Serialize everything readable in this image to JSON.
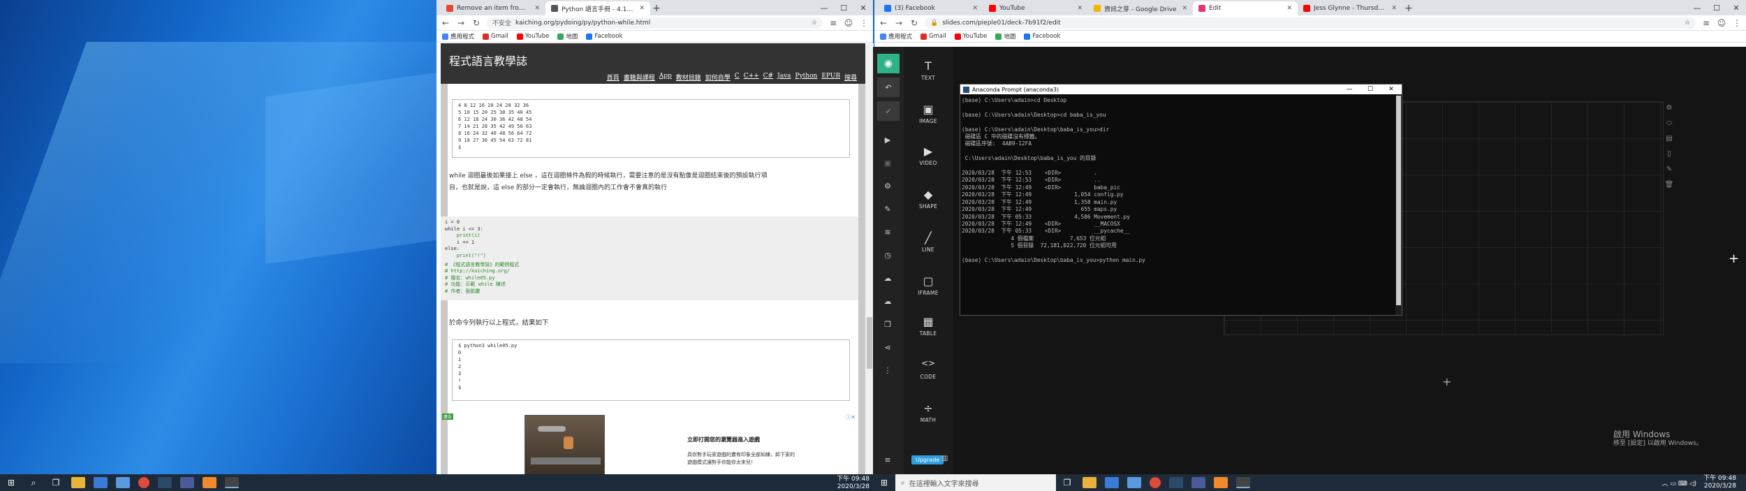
{
  "left_browser": {
    "tabs": [
      {
        "title": "Remove an item from a list in ...",
        "active": false,
        "color": "#ea4335"
      },
      {
        "title": "Python 語言手冊 - 4.12 迴圈與無...",
        "active": true,
        "color": "#555555"
      }
    ],
    "address": {
      "security": "不安全",
      "url": "kaiching.org/pydoing/py/python-while.html"
    },
    "bookmarks": [
      "應用程式",
      "Gmail",
      "YouTube",
      "地圖",
      "Facebook"
    ],
    "site": {
      "title": "程式語言教學誌",
      "nav": [
        "首頁",
        "書籍與課程",
        "App",
        "教材目錄",
        "如何自學",
        "C",
        "C++",
        "C#",
        "Java",
        "Python",
        "EPUB",
        "搜尋"
      ]
    },
    "code_top": [
      "4 8 12 16 20 24 28 32 36",
      "5 10 15 20 25 30 35 40 45",
      "6 12 18 24 30 36 42 48 54",
      "7 14 21 28 35 42 49 56 63",
      "8 16 24 32 40 48 56 64 72",
      "9 18 27 36 45 54 63 72 81",
      "$"
    ],
    "para1_line1": "while 迴圈最後如果接上 else ，這在迴圈條件為假的時候執行，需要注意的是沒有點像是迴圈結束後的預設執行項",
    "para1_line2": "目，也就是說，這 else 的部分一定會執行，無論迴圈內的工作會不會真的執行",
    "code_mid": [
      "i = 0",
      "while i <= 3:",
      "    print(i)",
      "    i += 1",
      "else:",
      "    print(\"!\")"
    ],
    "code_comments": [
      "# 《程式語言教學誌》的範例程式",
      "# http://kaiching.org/",
      "# 檔名：while05.py",
      "# 功能：示範 while 陳述",
      "# 作者：張凱慶"
    ],
    "para2": "於命令列執行以上程式，結果如下",
    "code_out": [
      "$ python3 while05.py",
      "0",
      "1",
      "2",
      "3",
      "!",
      "$"
    ],
    "ad": {
      "badge": "廣告",
      "headline": "立即打開您的瀏覽器進入遊戲",
      "body_line1": "具你對手玩家遊戲的畫有印象全部如練，卸下家的",
      "body_line2": "遊戲模式讓對手你能你太來兒！"
    },
    "taskbar": {
      "time": "下午 09:48",
      "date": "2020/3/28"
    }
  },
  "right_browser": {
    "tabs": [
      {
        "title": "(3) Facebook",
        "active": false,
        "color": "#1877f2"
      },
      {
        "title": "YouTube",
        "active": false,
        "color": "#ff0000"
      },
      {
        "title": "資訊之芽 - Google Drive",
        "active": false,
        "color": "#f4b400"
      },
      {
        "title": "Edit",
        "active": true,
        "color": "#e8336d"
      },
      {
        "title": "Jess Glynne - Thursday [Offi...",
        "active": false,
        "color": "#ff0000"
      }
    ],
    "address": {
      "url": "slides.com/pieple01/deck-7b91f2/edit"
    },
    "bookmarks": [
      "應用程式",
      "Gmail",
      "YouTube",
      "地圖",
      "Facebook"
    ],
    "tools": [
      {
        "label": "TEXT",
        "icon": "T"
      },
      {
        "label": "IMAGE",
        "icon": "▣"
      },
      {
        "label": "VIDEO",
        "icon": "▶"
      },
      {
        "label": "SHAPE",
        "icon": "◆"
      },
      {
        "label": "LINE",
        "icon": "╱"
      },
      {
        "label": "IFRAME",
        "icon": "▢"
      },
      {
        "label": "TABLE",
        "icon": "▦"
      },
      {
        "label": "CODE",
        "icon": "<>"
      },
      {
        "label": "MATH",
        "icon": "÷"
      }
    ],
    "upgrade_label": "Upgrade",
    "console": {
      "title": "Anaconda Prompt (anaconda3)",
      "lines": [
        "(base) C:\\Users\\adain>cd Desktop",
        "",
        "(base) C:\\Users\\adain\\Desktop>cd baba_is_you",
        "",
        "(base) C:\\Users\\adain\\Desktop\\baba_is_you>dir",
        " 磁碟區 C 中的磁碟沒有標籤。",
        " 磁碟區序號:  4AB9-12FA",
        "",
        " C:\\Users\\adain\\Desktop\\baba_is_you 的目錄",
        "",
        "2020/03/28  下午 12:53    <DIR>          .",
        "2020/03/28  下午 12:53    <DIR>          ..",
        "2020/03/28  下午 12:49    <DIR>          baba_pic",
        "2020/03/28  下午 12:49             1,054 config.py",
        "2020/03/28  下午 12:49             1,358 main.py",
        "2020/03/28  下午 12:49               655 maps.py",
        "2020/03/28  下午 05:33             4,586 Movement.py",
        "2020/03/28  下午 12:49    <DIR>          __MACOSX",
        "2020/03/28  下午 05:33    <DIR>          __pycache__",
        "               4 個檔案           7,653 位元組",
        "               5 個目錄  72,181,022,720 位元組可用",
        "",
        "(base) C:\\Users\\adain\\Desktop\\baba_is_you>python main.py"
      ]
    },
    "activate": {
      "line1": "啟用 Windows",
      "line2": "移至 [設定] 以啟用 Windows。"
    },
    "taskbar": {
      "search_placeholder": "在這裡輸入文字來搜尋",
      "time": "下午 09:48",
      "date": "2020/3/28"
    }
  }
}
